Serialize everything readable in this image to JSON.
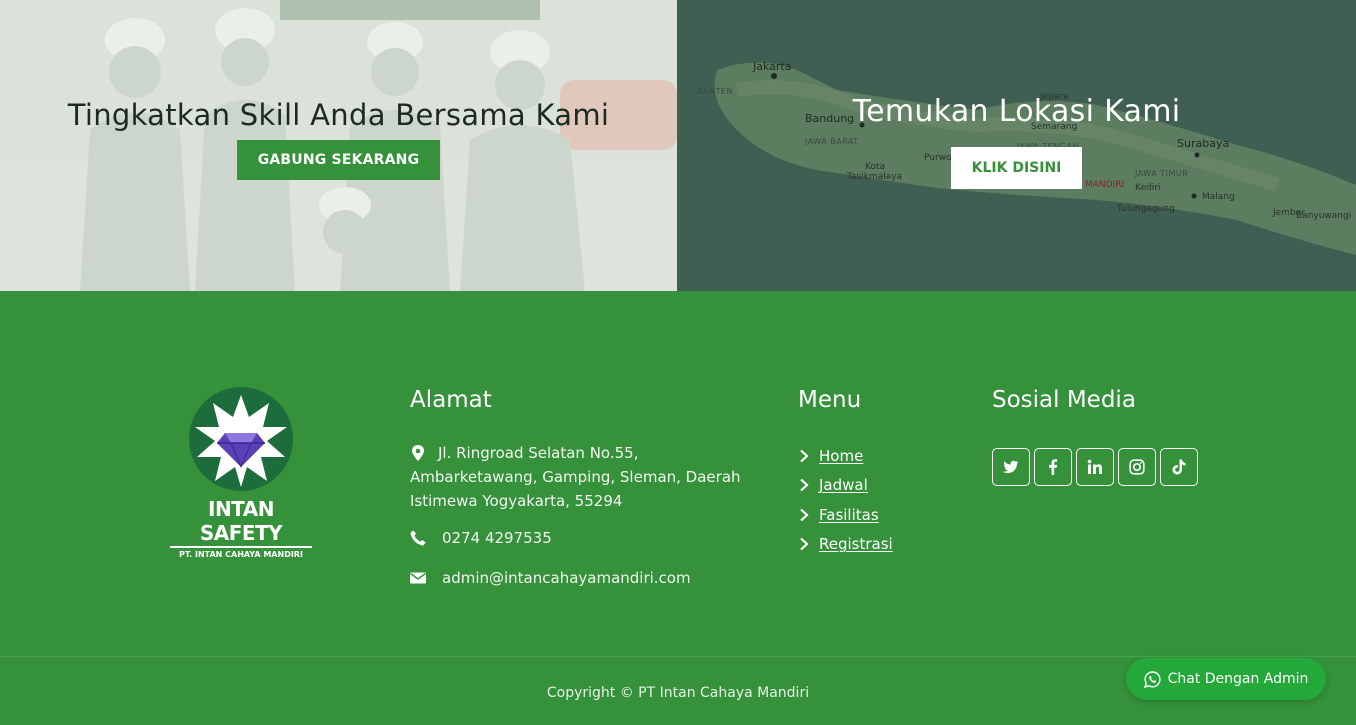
{
  "hero": {
    "left": {
      "title": "Tingkatkan Skill Anda Bersama Kami",
      "button_label": "GABUNG SEKARANG"
    },
    "right": {
      "title": "Temukan Lokasi Kami",
      "button_label": "KLIK DISINI",
      "map_labels": {
        "jakarta": "Jakarta",
        "banten": "BANTEN",
        "bandung": "Bandung",
        "jawa_barat": "JAWA BARAT",
        "purwo": "Purwo",
        "kota_tasik": "Kota",
        "tasikmalaya": "Tasikmalaya",
        "jepara": "Jepara",
        "semarang": "Semarang",
        "jawa_tengah": "JAWA TENGAH",
        "surabaya": "Surabaya",
        "jawa_timur": "JAWA TIMUR",
        "mandiri": "MANDIRI",
        "kediri": "Kediri",
        "malang": "Malang",
        "tulungagung": "Tulungagung",
        "jember": "Jember",
        "banyuwangi": "Banyuwangi"
      }
    }
  },
  "footer": {
    "brand": {
      "name": "INTAN SAFETY",
      "subtitle": "PT. INTAN CAHAYA MANDIRI"
    },
    "address": {
      "title": "Alamat",
      "street": "Jl. Ringroad Selatan No.55, Ambarketawang, Gamping, Sleman, Daerah Istimewa Yogyakarta, 55294",
      "phone": "0274 4297535",
      "email": "admin@intancahayamandiri.com"
    },
    "menu": {
      "title": "Menu",
      "items": [
        "Home",
        "Jadwal",
        "Fasilitas",
        "Registrasi"
      ]
    },
    "social": {
      "title": "Sosial Media",
      "icons": [
        "twitter-icon",
        "facebook-icon",
        "linkedin-icon",
        "instagram-icon",
        "tiktok-icon"
      ]
    },
    "copyright": "Copyright © PT Intan Cahaya Mandiri"
  },
  "chat": {
    "label": "Chat Dengan Admin"
  },
  "colors": {
    "brand_green": "#35913a",
    "chat_green": "#24a83a",
    "map_overlay": "#3e5e52",
    "white": "#ffffff"
  }
}
